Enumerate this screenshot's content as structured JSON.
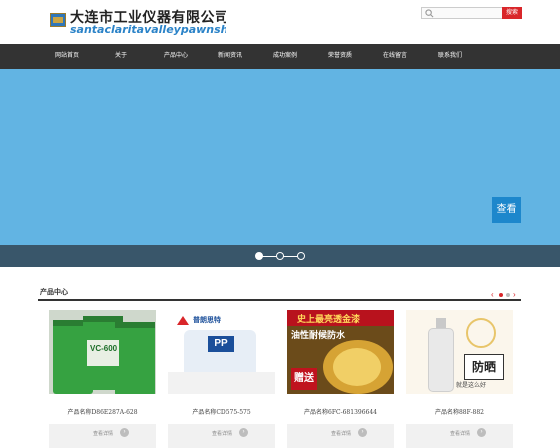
{
  "header": {
    "logo_cn": "大连市工业仪器有限公司",
    "logo_en": "santaclaritavalleypawnshop.com",
    "search_placeholder": "",
    "search_button": "搜索"
  },
  "nav": {
    "items": [
      {
        "label": "网站首页"
      },
      {
        "label": "关于"
      },
      {
        "label": "产品中心"
      },
      {
        "label": "新闻资讯"
      },
      {
        "label": "成功案例"
      },
      {
        "label": "荣誉资质"
      },
      {
        "label": "在线留言"
      },
      {
        "label": "联系我们"
      }
    ]
  },
  "banner": {
    "button_label": "查看",
    "slide_count": 3,
    "active_slide": 1
  },
  "products": {
    "title": "产品中心",
    "items": [
      {
        "caption": "产品名称D86E287A-628",
        "more": "查看详情",
        "image_text": "VC-600"
      },
      {
        "caption": "产品名称CD575-575",
        "more": "查看详情",
        "brand": "普朗思特",
        "image_text": "PP"
      },
      {
        "caption": "产品名称6FC-681396644",
        "more": "查看详情",
        "headline": "史上最亮透金漆",
        "subline": "油性耐候防水",
        "badge": "赠送"
      },
      {
        "caption": "产品名称88F-882",
        "more": "查看详情",
        "headline": "防晒",
        "subline": "就是这么好"
      }
    ]
  },
  "colors": {
    "nav_bg": "#333333",
    "banner_bg": "#62b4e3",
    "accent_red": "#d9262a",
    "accent_blue": "#1d87cc",
    "dotbar_bg": "#39566a"
  }
}
